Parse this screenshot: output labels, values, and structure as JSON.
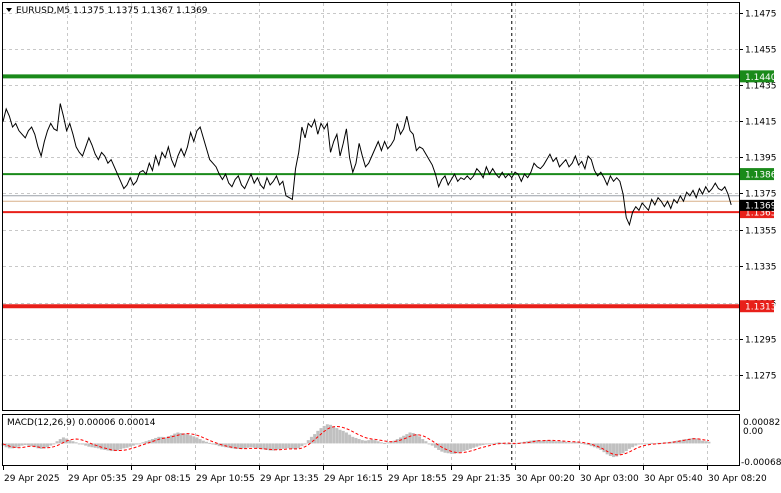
{
  "header": {
    "symbol_line": "EURUSD,M5  1.1375 1.1375 1.1367 1.1369"
  },
  "macd_panel": {
    "label": "MACD(12,26,9) 0.00006 0.00014",
    "ticks": [
      "0.00082",
      "0.00",
      "-0.00068"
    ]
  },
  "colors": {
    "grid": "#c8c8c8",
    "axis_frame": "#000000",
    "price_line": "#000000",
    "support_green": "#1a8a1a",
    "resistance_red": "#e8201a",
    "histogram": "#c0c0c0",
    "signal": "#ff0000",
    "price_tag_text": "#ffffff"
  },
  "chart_data": [
    {
      "type": "line",
      "title": "EURUSD,M5",
      "ohlc_header": {
        "open": 1.1375,
        "high": 1.1375,
        "low": 1.1367,
        "close": 1.1369
      },
      "ylim": [
        1.1267,
        1.1481
      ],
      "y_ticks": [
        "1.1475",
        "1.1455",
        "1.1435",
        "1.1415",
        "1.1395",
        "1.1375",
        "1.1355",
        "1.1335",
        "1.1315",
        "1.1295",
        "1.1275"
      ],
      "x_ticks": [
        "29 Apr 2025",
        "29 Apr 05:35",
        "29 Apr 08:15",
        "29 Apr 10:55",
        "29 Apr 13:35",
        "29 Apr 16:15",
        "29 Apr 18:55",
        "29 Apr 21:35",
        "30 Apr 00:20",
        "30 Apr 03:00",
        "30 Apr 05:40",
        "30 Apr 08:20"
      ],
      "x_index_range": [
        0,
        228
      ],
      "session_divider_index": 160,
      "series": [
        {
          "values": [
            1.1415,
            1.1422,
            1.1418,
            1.1412,
            1.1414,
            1.141,
            1.1408,
            1.1406,
            1.141,
            1.1412,
            1.1408,
            1.1401,
            1.1396,
            1.1404,
            1.141,
            1.1414,
            1.1411,
            1.141,
            1.1425,
            1.1418,
            1.141,
            1.1414,
            1.1408,
            1.1401,
            1.1398,
            1.1396,
            1.1401,
            1.1406,
            1.1402,
            1.1397,
            1.1394,
            1.1398,
            1.1396,
            1.1392,
            1.1394,
            1.139,
            1.1386,
            1.1382,
            1.1378,
            1.138,
            1.1384,
            1.138,
            1.1382,
            1.1387,
            1.1388,
            1.1386,
            1.1392,
            1.1388,
            1.1396,
            1.1391,
            1.1398,
            1.1395,
            1.1401,
            1.1394,
            1.139,
            1.1396,
            1.14,
            1.1396,
            1.1401,
            1.1409,
            1.1404,
            1.141,
            1.1412,
            1.1406,
            1.14,
            1.1394,
            1.1392,
            1.139,
            1.1386,
            1.1383,
            1.1386,
            1.1381,
            1.1379,
            1.1383,
            1.1385,
            1.138,
            1.1378,
            1.1382,
            1.1386,
            1.1381,
            1.1384,
            1.138,
            1.1378,
            1.1384,
            1.138,
            1.1382,
            1.1385,
            1.138,
            1.1382,
            1.1374,
            1.1373,
            1.1372,
            1.1389,
            1.1398,
            1.1412,
            1.1406,
            1.1414,
            1.1412,
            1.1416,
            1.1408,
            1.1414,
            1.1411,
            1.1414,
            1.1398,
            1.1404,
            1.1408,
            1.1396,
            1.1403,
            1.1411,
            1.1395,
            1.1387,
            1.1392,
            1.1403,
            1.1396,
            1.139,
            1.1392,
            1.1396,
            1.14,
            1.1404,
            1.1399,
            1.1404,
            1.14,
            1.1402,
            1.1405,
            1.1414,
            1.1408,
            1.1411,
            1.1418,
            1.141,
            1.1408,
            1.1399,
            1.1401,
            1.14,
            1.1397,
            1.1394,
            1.1391,
            1.1386,
            1.1379,
            1.1383,
            1.1385,
            1.138,
            1.1383,
            1.1386,
            1.1382,
            1.1384,
            1.1383,
            1.1385,
            1.1383,
            1.1385,
            1.1389,
            1.1387,
            1.1384,
            1.139,
            1.1386,
            1.1389,
            1.1386,
            1.1384,
            1.1387,
            1.1384,
            1.1386,
            1.1384,
            1.1387,
            1.1386,
            1.1382,
            1.1386,
            1.1384,
            1.1387,
            1.1392,
            1.139,
            1.1389,
            1.1391,
            1.1394,
            1.1397,
            1.1393,
            1.1395,
            1.139,
            1.1392,
            1.1394,
            1.139,
            1.1392,
            1.1396,
            1.1391,
            1.1393,
            1.1389,
            1.1396,
            1.1394,
            1.1388,
            1.1385,
            1.1387,
            1.1384,
            1.138,
            1.1385,
            1.1382,
            1.1384,
            1.1382,
            1.1375,
            1.1362,
            1.1358,
            1.1365,
            1.1368,
            1.1366,
            1.137,
            1.1368,
            1.1366,
            1.1372,
            1.1369,
            1.1373,
            1.1371,
            1.1368,
            1.1371,
            1.1367,
            1.1372,
            1.137,
            1.1374,
            1.1371,
            1.1376,
            1.1374,
            1.1377,
            1.1373,
            1.1378,
            1.1375,
            1.1379,
            1.1376,
            1.1378,
            1.1381,
            1.1378,
            1.1377,
            1.1379,
            1.1375,
            1.1369
          ]
        }
      ],
      "levels": [
        {
          "value": 1.144,
          "label": "1.1440",
          "color": "green",
          "weight": "thick"
        },
        {
          "value": 1.1386,
          "label": "1.1386",
          "color": "green",
          "weight": "thin"
        },
        {
          "value": 1.1365,
          "label": "1.1365",
          "color": "red",
          "weight": "thin"
        },
        {
          "value": 1.1313,
          "label": "1.1313",
          "color": "red",
          "weight": "thick"
        }
      ],
      "current_price_tag": {
        "value": 1.1369,
        "label": "1.1369"
      },
      "bid_ask_lines": [
        1.1371,
        1.1374
      ],
      "grid": true
    },
    {
      "type": "bar",
      "title": "MACD(12,26,9)",
      "readout": {
        "macd": 6e-05,
        "signal": 0.00014
      },
      "ylim": [
        -0.00068,
        0.00082
      ],
      "series": [
        {
          "role": "histogram",
          "values": [
            -8e-05,
            -0.00014,
            -0.00018,
            -0.00018,
            -0.00016,
            -0.00012,
            -8e-05,
            -6e-05,
            -8e-05,
            -0.0001,
            -0.00014,
            -0.00018,
            -0.0002,
            -0.00018,
            -0.00014,
            -8e-05,
            0.0,
            8e-05,
            0.00016,
            0.00022,
            0.00018,
            0.00012,
            8e-05,
            4e-05,
            0.0,
            -4e-05,
            -8e-05,
            -0.00012,
            -0.00014,
            -0.00016,
            -0.00018,
            -0.00022,
            -0.00024,
            -0.00026,
            -0.00028,
            -0.00028,
            -0.00026,
            -0.00022,
            -0.00018,
            -0.00016,
            -0.00012,
            -8e-05,
            -4e-05,
            0.0,
            4e-05,
            8e-05,
            0.00012,
            0.00016,
            0.0002,
            0.00024,
            0.00024,
            0.00022,
            0.00026,
            0.0003,
            0.00036,
            0.0004,
            0.00038,
            0.00036,
            0.00034,
            0.0003,
            0.00026,
            0.00022,
            0.00016,
            0.0001,
            6e-05,
            2e-05,
            -2e-05,
            -6e-05,
            -0.0001,
            -0.00012,
            -0.00014,
            -0.00016,
            -0.00018,
            -0.0002,
            -0.0002,
            -0.0002,
            -0.00018,
            -0.00016,
            -0.00014,
            -0.00016,
            -0.00018,
            -0.0002,
            -0.00022,
            -0.00024,
            -0.00026,
            -0.00026,
            -0.00024,
            -0.00022,
            -0.0002,
            -0.00018,
            -0.00018,
            -0.0002,
            -0.00022,
            -0.00018,
            -0.0001,
            0.0,
            0.00012,
            0.00024,
            0.00034,
            0.00046,
            0.00056,
            0.00064,
            0.0007,
            0.00068,
            0.00062,
            0.00056,
            0.0005,
            0.00046,
            0.0004,
            0.00032,
            0.00024,
            0.0002,
            0.00016,
            0.00012,
            0.0001,
            0.00012,
            0.00014,
            0.00012,
            8e-05,
            4e-05,
            2e-05,
            4e-05,
            6e-05,
            0.0001,
            0.00016,
            0.00022,
            0.00028,
            0.00034,
            0.0004,
            0.00038,
            0.00034,
            0.00026,
            0.00016,
            8e-05,
            0.0,
            -8e-05,
            -0.00016,
            -0.00024,
            -0.0003,
            -0.00034,
            -0.00036,
            -0.00038,
            -0.00038,
            -0.00036,
            -0.00032,
            -0.00028,
            -0.00024,
            -0.0002,
            -0.00016,
            -0.00012,
            -8e-05,
            -6e-05,
            -4e-05,
            -2e-05,
            0.0,
            2e-05,
            4e-05,
            2e-05,
            0.0,
            -2e-05,
            -2e-05,
            0.0,
            2e-05,
            4e-05,
            6e-05,
            8e-05,
            0.0001,
            0.00012,
            0.00012,
            0.0001,
            0.0001,
            0.00012,
            0.00012,
            0.0001,
            8e-05,
            8e-05,
            8e-05,
            6e-05,
            4e-05,
            4e-05,
            6e-05,
            4e-05,
            2e-05,
            -2e-05,
            -6e-05,
            -0.0001,
            -0.00014,
            -0.00018,
            -0.00024,
            -0.00032,
            -0.0004,
            -0.00046,
            -0.0005,
            -0.00048,
            -0.00042,
            -0.00036,
            -0.00028,
            -0.0002,
            -0.00014,
            -8e-05,
            -4e-05,
            -2e-05,
            0.0,
            0.0,
            2e-05,
            0.0,
            2e-05,
            2e-05,
            4e-05,
            4e-05,
            6e-05,
            8e-05,
            0.0001,
            0.00012,
            0.00014,
            0.00016,
            0.00018,
            0.0002,
            0.00018,
            0.00014,
            0.0001,
            8e-05,
            6e-05
          ]
        },
        {
          "role": "signal",
          "values": [
            -2e-05,
            -6e-05,
            -0.0001,
            -0.00013,
            -0.00015,
            -0.00016,
            -0.00015,
            -0.00013,
            -0.00011,
            -0.0001,
            -0.00011,
            -0.00013,
            -0.00015,
            -0.00016,
            -0.00016,
            -0.00015,
            -0.00012,
            -8e-05,
            -3e-05,
            3e-05,
            9e-05,
            0.00013,
            0.00015,
            0.00016,
            0.00015,
            0.00012,
            8e-05,
            3e-05,
            -2e-05,
            -6e-05,
            -0.0001,
            -0.00014,
            -0.00017,
            -0.0002,
            -0.00023,
            -0.00025,
            -0.00026,
            -0.00026,
            -0.00025,
            -0.00023,
            -0.0002,
            -0.00017,
            -0.00013,
            -9e-05,
            -5e-05,
            -1e-05,
            3e-05,
            7e-05,
            0.00011,
            0.00015,
            0.00018,
            0.0002,
            0.00022,
            0.00024,
            0.00027,
            0.0003,
            0.00033,
            0.00035,
            0.00036,
            0.00035,
            0.00033,
            0.0003,
            0.00026,
            0.00021,
            0.00016,
            0.00011,
            6e-05,
            2e-05,
            -2e-05,
            -6e-05,
            -9e-05,
            -0.00012,
            -0.00014,
            -0.00016,
            -0.00018,
            -0.00019,
            -0.00019,
            -0.00019,
            -0.00018,
            -0.00018,
            -0.00018,
            -0.00019,
            -0.0002,
            -0.00021,
            -0.00022,
            -0.00023,
            -0.00023,
            -0.00023,
            -0.00022,
            -0.00021,
            -0.0002,
            -0.0002,
            -0.0002,
            -0.0002,
            -0.00017,
            -0.00012,
            -5e-05,
            4e-05,
            0.00014,
            0.00024,
            0.00034,
            0.00044,
            0.00052,
            0.00058,
            0.00061,
            0.00062,
            0.00061,
            0.00058,
            0.00054,
            0.00049,
            0.00043,
            0.00037,
            0.00031,
            0.00026,
            0.00021,
            0.00018,
            0.00016,
            0.00015,
            0.00013,
            0.00011,
            9e-05,
            7e-05,
            6e-05,
            7e-05,
            9e-05,
            0.00012,
            0.00016,
            0.00021,
            0.00026,
            0.0003,
            0.00032,
            0.00031,
            0.00028,
            0.00023,
            0.00016,
            9e-05,
            1e-05,
            -7e-05,
            -0.00014,
            -0.0002,
            -0.00025,
            -0.00029,
            -0.00032,
            -0.00034,
            -0.00034,
            -0.00033,
            -0.00031,
            -0.00028,
            -0.00025,
            -0.00021,
            -0.00017,
            -0.00014,
            -0.00011,
            -8e-05,
            -5e-05,
            -3e-05,
            -1e-05,
            0.0,
            1e-05,
            1e-05,
            0.0,
            0.0,
            0.0,
            1e-05,
            2e-05,
            3e-05,
            5e-05,
            7e-05,
            9e-05,
            0.0001,
            0.0001,
            0.00011,
            0.00011,
            0.00011,
            0.0001,
            0.0001,
            9e-05,
            8e-05,
            7e-05,
            6e-05,
            6e-05,
            5e-05,
            4e-05,
            2e-05,
            0.0,
            -3e-05,
            -7e-05,
            -0.00011,
            -0.00016,
            -0.00022,
            -0.00029,
            -0.00035,
            -0.0004,
            -0.00042,
            -0.00042,
            -0.0004,
            -0.00036,
            -0.00031,
            -0.00025,
            -0.00019,
            -0.00014,
            -0.0001,
            -7e-05,
            -5e-05,
            -3e-05,
            -2e-05,
            -1e-05,
            0.0,
            1e-05,
            2e-05,
            3e-05,
            5e-05,
            7e-05,
            9e-05,
            0.00011,
            0.00013,
            0.00015,
            0.00017,
            0.00017,
            0.00016,
            0.00014,
            0.00012,
            0.0001
          ]
        }
      ],
      "grid": true
    }
  ]
}
